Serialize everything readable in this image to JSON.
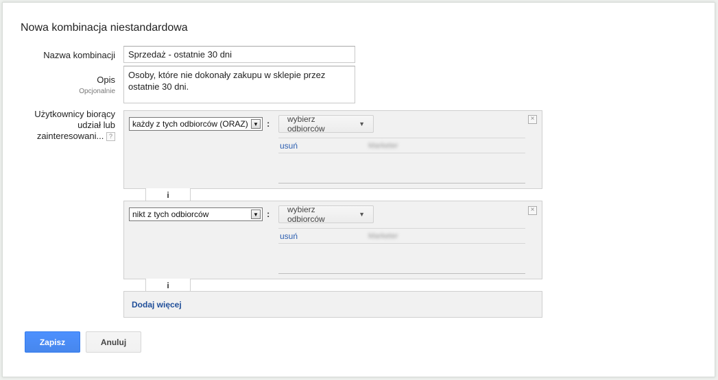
{
  "title": "Nowa kombinacja niestandardowa",
  "form": {
    "name_label": "Nazwa kombinacji",
    "name_value": "Sprzedaż - ostatnie 30 dni",
    "desc_label": "Opis",
    "desc_sublabel": "Opcjonalnie",
    "desc_value": "Osoby, które nie dokonały zakupu w sklepie przez ostatnie 30 dni.",
    "users_label_line1": "Użytkownicy biorący",
    "users_label_line2": "udział lub",
    "users_label_line3": "zainteresowani...",
    "help_glyph": "?"
  },
  "groups": [
    {
      "select_value": "każdy z tych odbiorców (ORAZ)",
      "colon": ":",
      "audience_button": "wybierz odbiorców",
      "remove_link": "usuń",
      "audience_name": "Marketer",
      "close_glyph": "×"
    },
    {
      "select_value": "nikt z tych odbiorców",
      "colon": ":",
      "audience_button": "wybierz odbiorców",
      "remove_link": "usuń",
      "audience_name": "Marketer",
      "close_glyph": "×"
    }
  ],
  "connector": "i",
  "add_more": "Dodaj więcej",
  "actions": {
    "save": "Zapisz",
    "cancel": "Anuluj"
  },
  "icons": {
    "select_arrow": "▼",
    "dropdown_caret": "▼"
  }
}
